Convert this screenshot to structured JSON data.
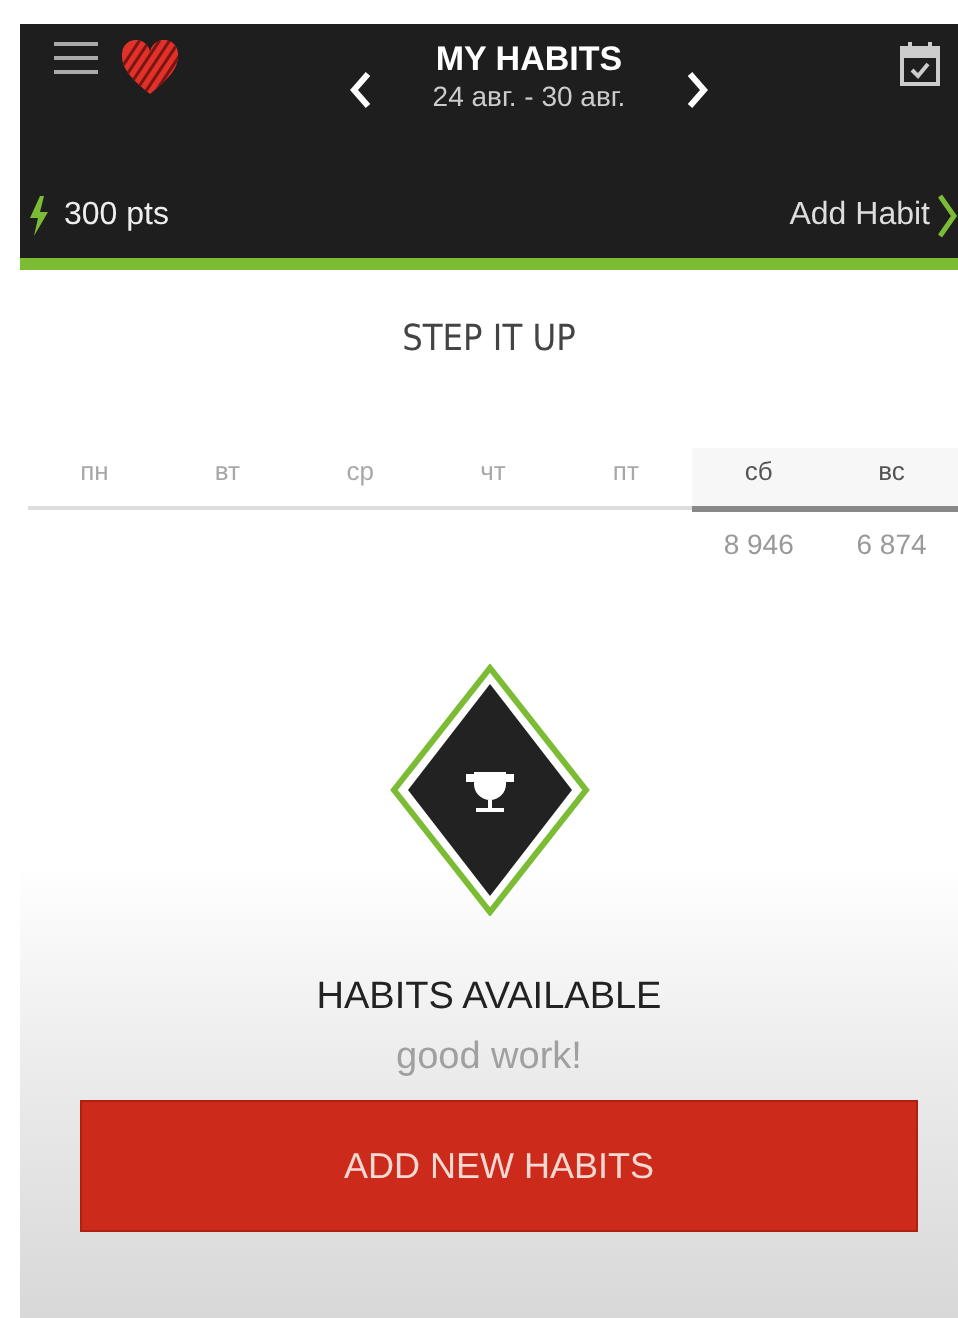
{
  "header": {
    "title": "MY HABITS",
    "date_range": "24 авг. - 30 авг.",
    "points": "300 pts",
    "add_habit": "Add Habit"
  },
  "section_title": "STEP IT UP",
  "days": [
    {
      "label": "пн",
      "selected": false
    },
    {
      "label": "вт",
      "selected": false
    },
    {
      "label": "ср",
      "selected": false
    },
    {
      "label": "чт",
      "selected": false
    },
    {
      "label": "пт",
      "selected": false
    },
    {
      "label": "сб",
      "selected": true,
      "steps": "8 946"
    },
    {
      "label": "вс",
      "selected": true,
      "steps": "6 874"
    }
  ],
  "status": {
    "title": "HABITS AVAILABLE",
    "subtitle": "good work!"
  },
  "button": "ADD NEW HABITS"
}
